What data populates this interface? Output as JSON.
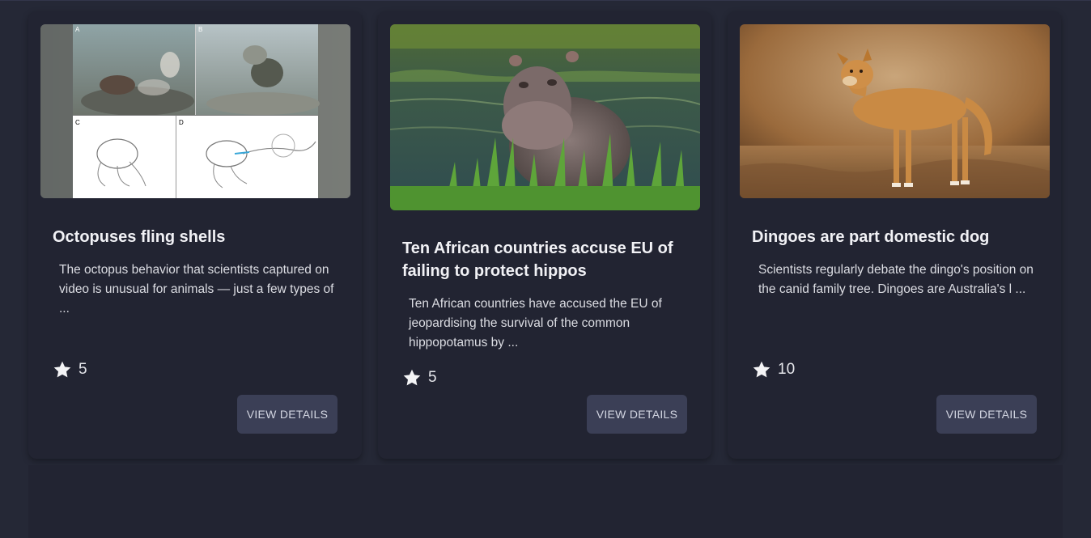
{
  "cards": [
    {
      "title": "Octopuses fling shells",
      "description": "The octopus behavior that scientists captured on video is unusual for animals — just a few types of ...",
      "rating": "5",
      "button": "VIEW DETAILS",
      "image_panels": [
        "A",
        "B",
        "C",
        "D"
      ]
    },
    {
      "title": "Ten African countries accuse EU of failing to protect hippos",
      "description": "Ten African countries have accused the EU of jeopardising the survival of the common hippopotamus by ...",
      "rating": "5",
      "button": "VIEW DETAILS"
    },
    {
      "title": "Dingoes are part domestic dog",
      "description": "Scientists regularly debate the dingo's position on the canid family tree. Dingoes are Australia's l ...",
      "rating": "10",
      "button": "VIEW DETAILS"
    }
  ],
  "icons": {
    "rating": "star-icon"
  },
  "colors": {
    "background": "#252836",
    "card": "#222432",
    "button": "#3b3f56"
  }
}
